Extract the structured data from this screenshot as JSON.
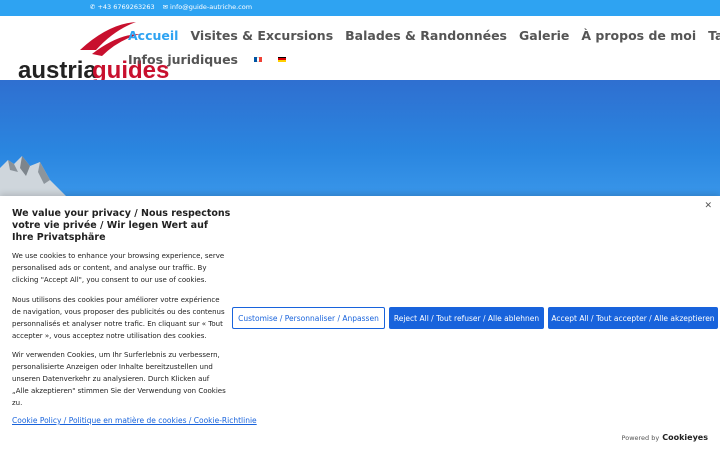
{
  "topbar": {
    "phone": "+43 6769263263",
    "email": "info@guide-autriche.com",
    "phone_icon": "phone-icon",
    "email_icon": "mail-icon"
  },
  "logo": {
    "text_part1": "austria",
    "text_part2": "guides"
  },
  "nav": {
    "items": [
      {
        "label": "Accueil"
      },
      {
        "label": "Visites & Excursions"
      },
      {
        "label": "Balades & Randonnées"
      },
      {
        "label": "Galerie"
      },
      {
        "label": "À propos de moi"
      },
      {
        "label": "Tarifs"
      }
    ],
    "second_row": "Infos juridiques",
    "lang_fr": "french-flag-icon",
    "lang_de": "german-flag-icon"
  },
  "colors": {
    "accent": "#2ea3f2",
    "button": "#1863dc",
    "logo_red": "#c8102e"
  },
  "cookie": {
    "title": "We value your privacy / Nous respectons votre vie privée / Wir legen Wert auf Ihre Privatsphäre",
    "text_en": "We use cookies to enhance your browsing experience, serve personalised ads or content, and analyse our traffic. By clicking \"Accept All\", you consent to our use of cookies.",
    "text_fr": "Nous utilisons des cookies pour améliorer votre expérience de navigation, vous proposer des publicités ou des contenus personnalisés et analyser notre trafic. En cliquant sur « Tout accepter », vous acceptez notre utilisation des cookies.",
    "text_de": "Wir verwenden Cookies, um Ihr Surferlebnis zu verbessern, personalisierte Anzeigen oder Inhalte bereitzustellen und unseren Datenverkehr zu analysieren. Durch Klicken auf „Alle akzeptieren\" stimmen Sie der Verwendung von Cookies zu.",
    "policy_link": "Cookie Policy / Politique en matière de cookies / Cookie-Richtlinie",
    "btn_customise": "Customise / Personnaliser / Anpassen",
    "btn_reject": "Reject All / Tout refuser / Alle ablehnen",
    "btn_accept": "Accept All / Tout accepter / Alle akzeptieren",
    "powered_by": "Powered by",
    "powered_brand": "Cookieyes",
    "close_icon": "close-icon"
  }
}
